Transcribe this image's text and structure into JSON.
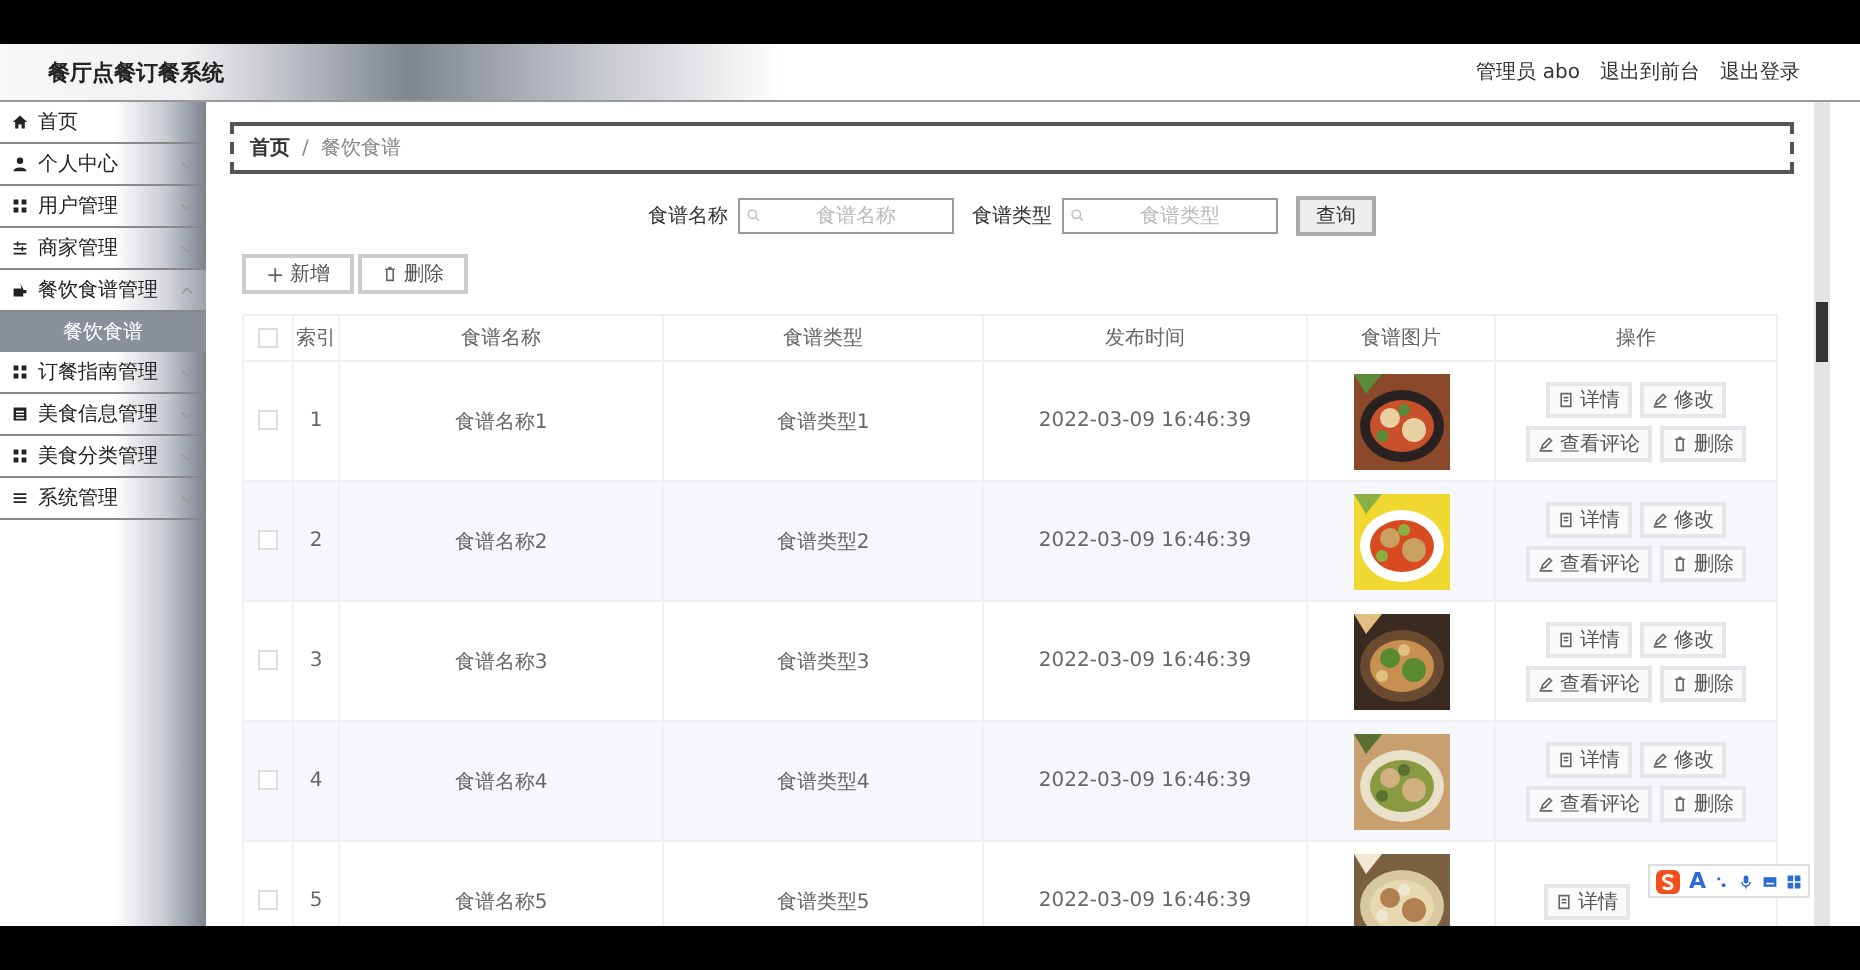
{
  "header": {
    "title": "餐厅点餐订餐系统",
    "links": [
      "管理员 abo",
      "退出到前台",
      "退出登录"
    ]
  },
  "sidebar": {
    "items": [
      {
        "label": "首页",
        "expanded": false
      },
      {
        "label": "个人中心",
        "expanded": false
      },
      {
        "label": "用户管理",
        "expanded": false
      },
      {
        "label": "商家管理",
        "expanded": false
      },
      {
        "label": "餐饮食谱管理",
        "expanded": true,
        "children": [
          {
            "label": "餐饮食谱",
            "selected": true
          }
        ]
      },
      {
        "label": "订餐指南管理",
        "expanded": false
      },
      {
        "label": "美食信息管理",
        "expanded": false
      },
      {
        "label": "美食分类管理",
        "expanded": false
      },
      {
        "label": "系统管理",
        "expanded": false
      }
    ]
  },
  "breadcrumb": [
    "首页",
    "/",
    "餐饮食谱"
  ],
  "search": {
    "fields": [
      {
        "label": "食谱名称",
        "placeholder": "食谱名称"
      },
      {
        "label": "食谱类型",
        "placeholder": "食谱类型"
      }
    ],
    "button": "查询"
  },
  "actions": [
    {
      "icon": "+",
      "label": "新增"
    },
    {
      "label": "删除"
    }
  ],
  "table": {
    "columns": [
      "索引",
      "食谱名称",
      "食谱类型",
      "发布时间",
      "食谱图片",
      "操作"
    ],
    "header_checked": false,
    "rows": [
      {
        "index": "1",
        "name": "食谱名称1",
        "type": "食谱类型1",
        "time": "2022-03-09 16:46:39",
        "checked": false,
        "buttons": [
          "详情",
          "修改",
          "查看评论",
          "删除"
        ]
      },
      {
        "index": "2",
        "name": "食谱名称2",
        "type": "食谱类型2",
        "time": "2022-03-09 16:46:39",
        "checked": false,
        "buttons": [
          "详情",
          "修改",
          "查看评论",
          "删除"
        ]
      },
      {
        "index": "3",
        "name": "食谱名称3",
        "type": "食谱类型3",
        "time": "2022-03-09 16:46:39",
        "checked": false,
        "buttons": [
          "详情",
          "修改",
          "查看评论",
          "删除"
        ]
      },
      {
        "index": "4",
        "name": "食谱名称4",
        "type": "食谱类型4",
        "time": "2022-03-09 16:46:39",
        "checked": false,
        "buttons": [
          "详情",
          "修改",
          "查看评论",
          "删除"
        ]
      },
      {
        "index": "5",
        "name": "食谱名称5",
        "type": "食谱类型5",
        "time": "2022-03-09 16:46:39",
        "checked": false,
        "buttons": [
          "详情"
        ]
      }
    ]
  },
  "ime_toolbar": {
    "label": "A"
  }
}
